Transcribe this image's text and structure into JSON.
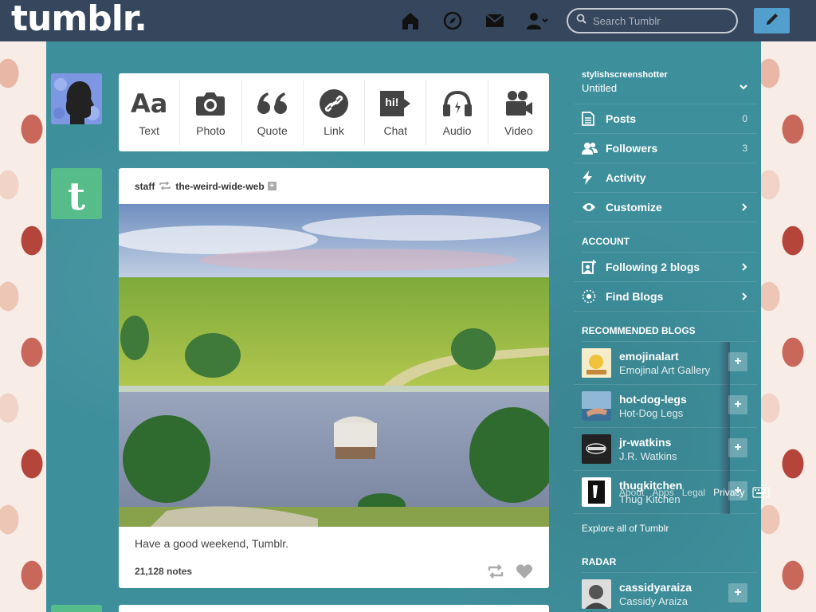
{
  "header": {
    "logo": "tumblr.",
    "search_placeholder": "Search Tumblr"
  },
  "post_types": [
    {
      "label": "Text",
      "icon": "text-icon",
      "glyph": "Aa"
    },
    {
      "label": "Photo",
      "icon": "camera-icon"
    },
    {
      "label": "Quote",
      "icon": "quote-icon",
      "glyph": "❝"
    },
    {
      "label": "Link",
      "icon": "link-icon"
    },
    {
      "label": "Chat",
      "icon": "chat-icon",
      "glyph": "hi!"
    },
    {
      "label": "Audio",
      "icon": "headphones-icon"
    },
    {
      "label": "Video",
      "icon": "video-camera-icon"
    }
  ],
  "post": {
    "author": "staff",
    "reblogged_from": "the-weird-wide-web",
    "caption": "Have a good weekend, Tumblr.",
    "notes": "21,128 notes"
  },
  "sidebar": {
    "blog_name": "stylishscreenshotter",
    "blog_title": "Untitled",
    "rows": [
      {
        "label": "Posts",
        "count": "0"
      },
      {
        "label": "Followers",
        "count": "3"
      },
      {
        "label": "Activity"
      },
      {
        "label": "Customize"
      }
    ],
    "account_heading": "ACCOUNT",
    "account_rows": [
      {
        "label": "Following 2 blogs"
      },
      {
        "label": "Find Blogs"
      }
    ],
    "recommended_heading": "RECOMMENDED BLOGS",
    "recommended": [
      {
        "name": "emojinalart",
        "title": "Emojinal Art Gallery"
      },
      {
        "name": "hot-dog-legs",
        "title": "Hot-Dog Legs"
      },
      {
        "name": "jr-watkins",
        "title": "J.R. Watkins"
      },
      {
        "name": "thugkitchen",
        "title": "Thug Kitchen"
      }
    ],
    "explore": "Explore all of Tumblr",
    "radar_heading": "RADAR",
    "radar": {
      "name": "cassidyaraiza",
      "title": "Cassidy Araiza"
    }
  },
  "footer_overlay": {
    "about": "About",
    "apps": "Apps",
    "legal": "Legal",
    "privacy": "Privacy"
  },
  "colors": {
    "header": "#36465d",
    "accent": "#529ecc",
    "background": "#3e8f9c"
  }
}
